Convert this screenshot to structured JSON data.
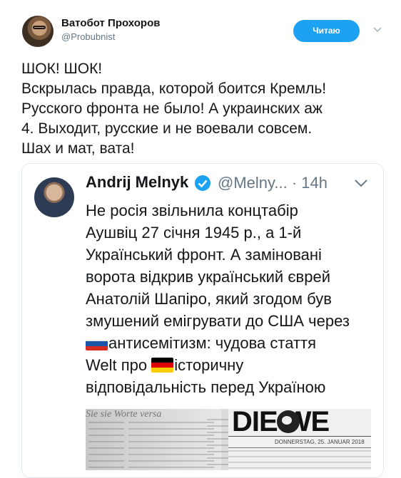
{
  "header": {
    "display_name": "Ватобот Прохоров",
    "handle": "@Probubnist",
    "follow_label": "Читаю",
    "follow_color": "#1da1f2"
  },
  "tweet": {
    "lines": [
      "ШОК! ШОК!",
      "Вскрылась правда, которой боится Кремль!",
      "Русского фронта не было! А украинских аж",
      "4. Выходит, русские и не воевали совсем.",
      "Шах и мат, вата!"
    ]
  },
  "quote": {
    "name": "Andrij Melnyk",
    "handle_time": "@Melny... · 14h",
    "verified_color": "#1da1f2",
    "lines": [
      "Не росія звільнила концтабір",
      "Аушвіц 27 січня 1945 р., а 1-й",
      "Український фронт. А заміновані",
      "ворота відкрив український єврей",
      "Анатолій Шапіро, який згодом був",
      "змушений емігрувати до США через"
    ],
    "line7_text": "антисемітизм: чудова стаття",
    "line8_pre": "Welt про ",
    "line8_post": "історичну",
    "line9": "відповідальність перед Україною",
    "flag_russia": "russia-flag-icon",
    "flag_germany": "germany-flag-icon"
  },
  "image": {
    "left_strip": "Sie sie Worte versa",
    "masthead": "DIE  WE",
    "dateline": "DONNERSTAG, 25. JANUAR 2018"
  }
}
